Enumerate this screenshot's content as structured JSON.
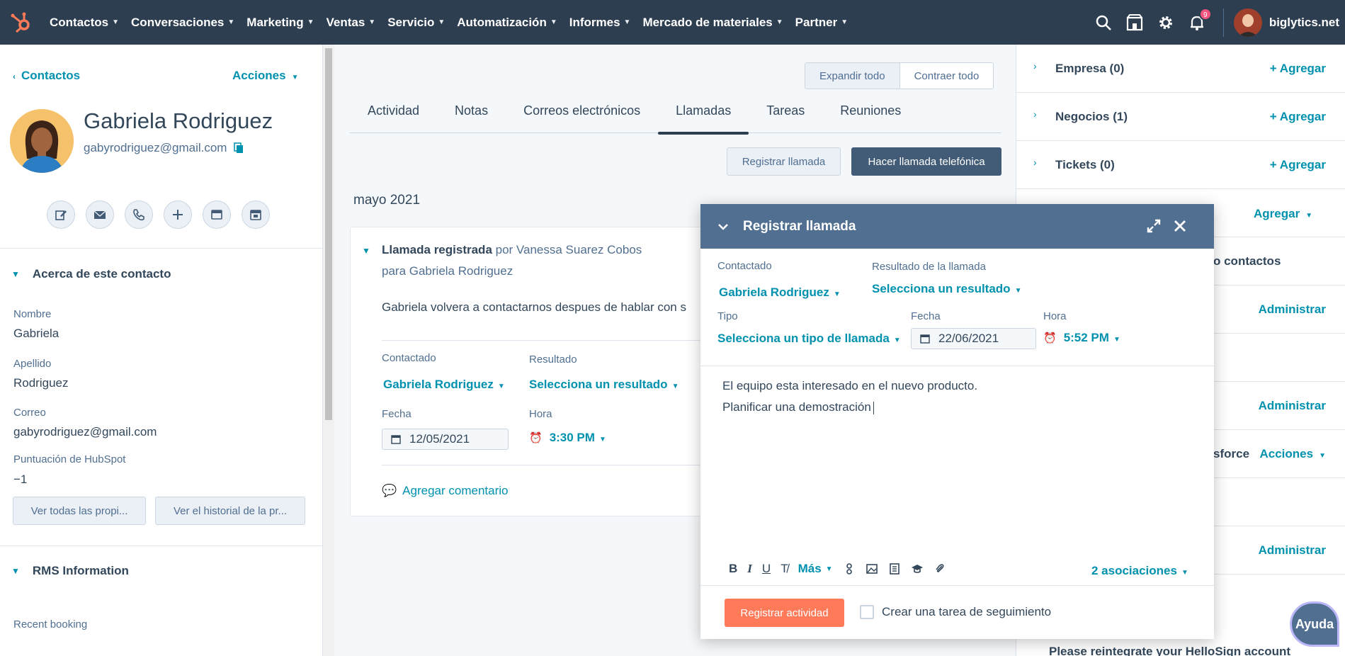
{
  "nav": {
    "items": [
      "Contactos",
      "Conversaciones",
      "Marketing",
      "Ventas",
      "Servicio",
      "Automatización",
      "Informes",
      "Mercado de materiales",
      "Partner"
    ],
    "notification_count": "9",
    "account": "biglytics.net"
  },
  "left": {
    "back_label": "Contactos",
    "actions_label": "Acciones",
    "contact_name": "Gabriela Rodriguez",
    "contact_email": "gabyrodriguez@gmail.com",
    "about_title": "Acerca de este contacto",
    "props": [
      {
        "label": "Nombre",
        "value": "Gabriela"
      },
      {
        "label": "Apellido",
        "value": "Rodriguez"
      },
      {
        "label": "Correo",
        "value": "gabyrodriguez@gmail.com"
      },
      {
        "label": "Puntuación de HubSpot",
        "value": "−1"
      }
    ],
    "view_all_label": "Ver todas las propi...",
    "history_label": "Ver el historial de la pr...",
    "rms_title": "RMS Information",
    "recent_booking_label": "Recent booking"
  },
  "middle": {
    "expand_all": "Expandir todo",
    "collapse_all": "Contraer todo",
    "tabs": [
      "Actividad",
      "Notas",
      "Correos electrónicos",
      "Llamadas",
      "Tareas",
      "Reuniones"
    ],
    "active_tab": "Llamadas",
    "log_call_btn": "Registrar llamada",
    "make_call_btn": "Hacer llamada telefónica",
    "month": "mayo 2021",
    "card": {
      "title_bold": "Llamada registrada",
      "title_rest": " por Vanessa Suarez Cobos",
      "subtitle": "para Gabriela Rodriguez",
      "body": "Gabriela volvera a contactarnos despues de hablar con s",
      "contacted_label": "Contactado",
      "contacted_value": "Gabriela Rodriguez",
      "result_label": "Resultado",
      "result_value": "Selecciona un resultado",
      "date_label": "Fecha",
      "date_value": "12/05/2021",
      "time_label": "Hora",
      "time_value": "3:30 PM",
      "comment_label": "Agregar comentario"
    }
  },
  "right": {
    "empresa": "Empresa (0)",
    "negocios": "Negocios (1)",
    "tickets": "Tickets (0)",
    "add_label": "+ Agregar",
    "agregar": "Agregar",
    "contacts_fragment": "o contactos",
    "administrar": "Administrar",
    "sforce_fragment": "sforce",
    "acciones": "Acciones",
    "bottom_text": "Please reintegrate your HelloSign account"
  },
  "modal": {
    "title": "Registrar llamada",
    "contacted_label": "Contactado",
    "contacted_value": "Gabriela Rodriguez",
    "result_label": "Resultado de la llamada",
    "result_value": "Selecciona un resultado",
    "type_label": "Tipo",
    "type_value": "Selecciona un tipo de llamada",
    "date_label": "Fecha",
    "date_value": "22/06/2021",
    "time_label": "Hora",
    "time_value": "5:52 PM",
    "note_line1": "El equipo esta interesado en el nuevo producto.",
    "note_line2": "Planificar una demostración",
    "more_label": "Más",
    "associations": "2 asociaciones",
    "submit_label": "Registrar actividad",
    "followup_label": "Crear una tarea de seguimiento"
  },
  "help_label": "Ayuda",
  "colors": {
    "nav_bg": "#2d3e50",
    "link": "#0091ae",
    "primary_btn": "#ff7a59",
    "modal_header": "#516f90",
    "dark_btn": "#425b76"
  }
}
